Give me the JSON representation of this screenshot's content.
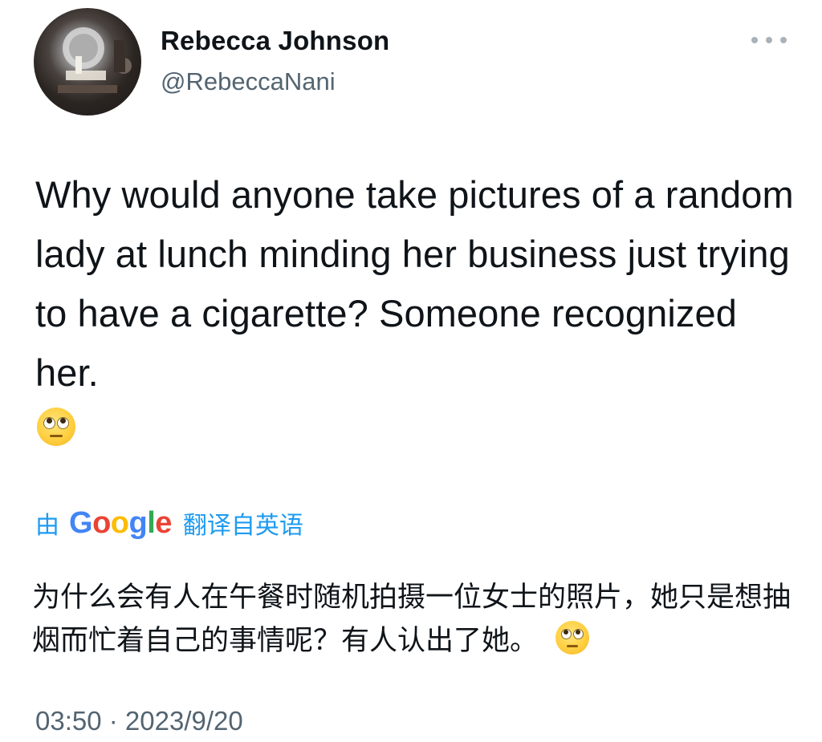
{
  "author": {
    "display_name": "Rebecca Johnson",
    "handle": "@RebeccaNani",
    "avatar_icon": "profile-photo-avatar"
  },
  "menu": {
    "more_icon": "more-horizontal-icon"
  },
  "tweet": {
    "text": "Why would anyone take pictures of a random lady at lunch minding her business just trying to have a cigarette? Someone recognized her.",
    "emoji": "face-with-rolling-eyes"
  },
  "translation": {
    "prefix": "由",
    "provider_letters": [
      "G",
      "o",
      "o",
      "g",
      "l",
      "e"
    ],
    "suffix": "翻译自英语",
    "text": "为什么会有人在午餐时随机拍摄一位女士的照片，她只是想抽烟而忙着自己的事情呢？有人认出了她。",
    "emoji": "face-with-rolling-eyes"
  },
  "meta": {
    "timestamp": "03:50 · 2023/9/20"
  },
  "colors": {
    "link": "#1d9bf0",
    "secondary_text": "#536471",
    "primary_text": "#0f1419"
  }
}
